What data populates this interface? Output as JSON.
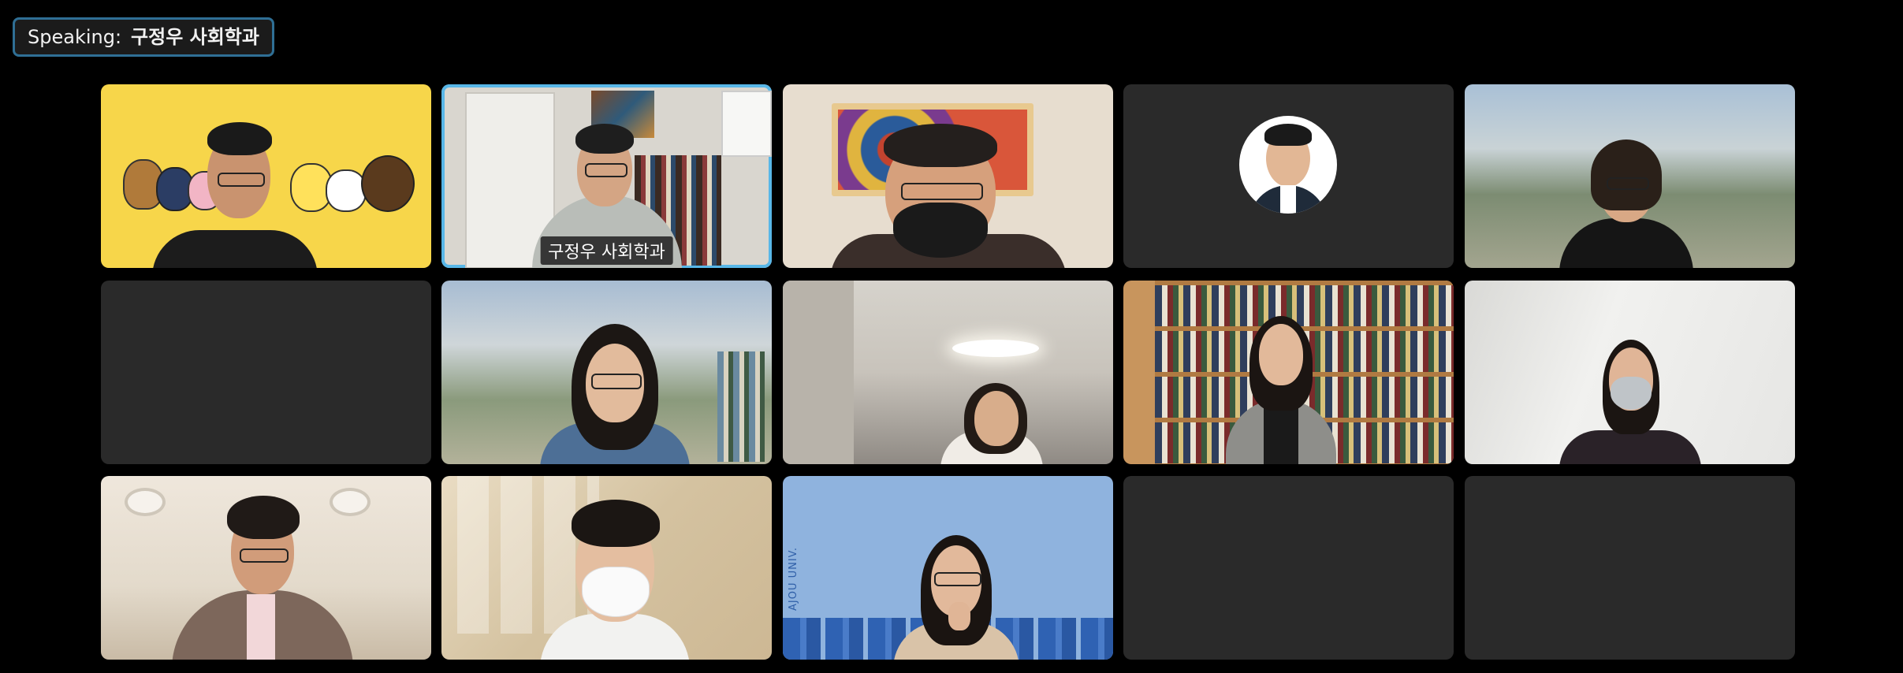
{
  "speaking": {
    "label": "Speaking:",
    "name": "구정우 사회학과"
  },
  "participants": [
    {
      "row": 1,
      "col": 1,
      "background": "yellow-character-backdrop",
      "active": false,
      "name_label": ""
    },
    {
      "row": 1,
      "col": 2,
      "background": "office-bookshelf",
      "active": true,
      "name_label": "구정우 사회학과"
    },
    {
      "row": 1,
      "col": 3,
      "background": "framed-mandala-wall",
      "active": false,
      "name_label": ""
    },
    {
      "row": 1,
      "col": 4,
      "background": "profile-photo-only",
      "active": false,
      "name_label": ""
    },
    {
      "row": 1,
      "col": 5,
      "background": "blurred-mountain",
      "active": false,
      "name_label": ""
    },
    {
      "row": 2,
      "col": 1,
      "background": "camera-off",
      "active": false,
      "name_label": ""
    },
    {
      "row": 2,
      "col": 2,
      "background": "blurred-mountain",
      "active": false,
      "name_label": ""
    },
    {
      "row": 2,
      "col": 3,
      "background": "office-room",
      "active": false,
      "name_label": ""
    },
    {
      "row": 2,
      "col": 4,
      "background": "library-bookshelf",
      "active": false,
      "name_label": ""
    },
    {
      "row": 2,
      "col": 5,
      "background": "white-wall",
      "active": false,
      "name_label": ""
    },
    {
      "row": 3,
      "col": 1,
      "background": "office-ceiling",
      "active": false,
      "name_label": ""
    },
    {
      "row": 3,
      "col": 2,
      "background": "window-shadow-wall",
      "active": false,
      "name_label": ""
    },
    {
      "row": 3,
      "col": 3,
      "background": "blue-campus-backdrop",
      "active": false,
      "name_label": ""
    },
    {
      "row": 3,
      "col": 4,
      "background": "camera-off",
      "active": false,
      "name_label": ""
    },
    {
      "row": 3,
      "col": 5,
      "background": "camera-off",
      "active": false,
      "name_label": ""
    }
  ],
  "backdrop_text": {
    "campus_logo": "AJOU UNIV."
  },
  "colors": {
    "background": "#000000",
    "tile_empty": "#2a2a2a",
    "active_border": "#58b7e8",
    "badge_border": "#2f6f95",
    "yellow_backdrop": "#f7d64a",
    "blue_backdrop": "#8fb3de"
  }
}
